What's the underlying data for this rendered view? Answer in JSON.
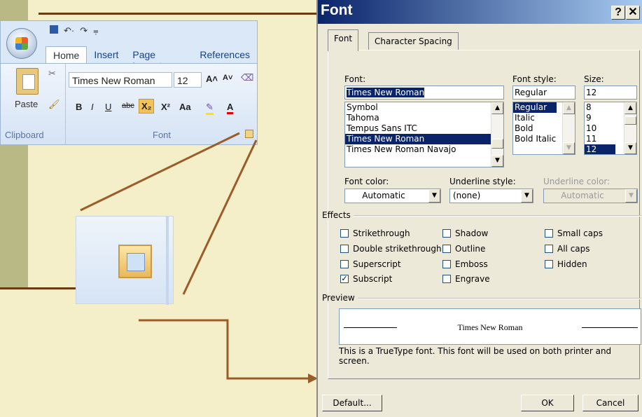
{
  "colors": {
    "slide_bg": "#f4efc8",
    "accent_line": "#6b3b10",
    "dialog_titlebar": "#0a246a",
    "dialog_bg": "#ece9d8",
    "selection": "#0a246a"
  },
  "ribbon": {
    "tabs": [
      "Home",
      "Insert",
      "Page Layout",
      "References"
    ],
    "font_name": "Times New Roman",
    "font_size": "12",
    "paste_label": "Paste",
    "group_clipboard": "Clipboard",
    "group_font": "Font"
  },
  "dialog": {
    "title": "Font",
    "help_btn": "?",
    "close_btn": "✕",
    "tabs": [
      "Font",
      "Character Spacing"
    ],
    "font_label": "Font:",
    "font_value": "Times New Roman",
    "font_list": [
      "Symbol",
      "Tahoma",
      "Tempus Sans ITC",
      "Times New Roman",
      "Times New Roman Navajo"
    ],
    "style_label": "Font style:",
    "style_value": "Regular",
    "style_list": [
      "Regular",
      "Italic",
      "Bold",
      "Bold Italic"
    ],
    "size_label": "Size:",
    "size_value": "12",
    "size_list": [
      "8",
      "9",
      "10",
      "11",
      "12"
    ],
    "font_color_label": "Font color:",
    "font_color_value": "Automatic",
    "underline_style_label": "Underline style:",
    "underline_style_value": "(none)",
    "underline_color_label": "Underline color:",
    "underline_color_value": "Automatic",
    "effects_label": "Effects",
    "effects": [
      {
        "label": "Strikethrough",
        "checked": false
      },
      {
        "label": "Double strikethrough",
        "checked": false
      },
      {
        "label": "Superscript",
        "checked": false
      },
      {
        "label": "Subscript",
        "checked": true
      },
      {
        "label": "Shadow",
        "checked": false
      },
      {
        "label": "Outline",
        "checked": false
      },
      {
        "label": "Emboss",
        "checked": false
      },
      {
        "label": "Engrave",
        "checked": false
      },
      {
        "label": "Small caps",
        "checked": false
      },
      {
        "label": "All caps",
        "checked": false
      },
      {
        "label": "Hidden",
        "checked": false
      }
    ],
    "preview_label": "Preview",
    "preview_text": "Times New Roman",
    "note": "This is a TrueType font. This font will be used on both printer and screen.",
    "default_btn": "Default...",
    "ok_btn": "OK",
    "cancel_btn": "Cancel"
  }
}
